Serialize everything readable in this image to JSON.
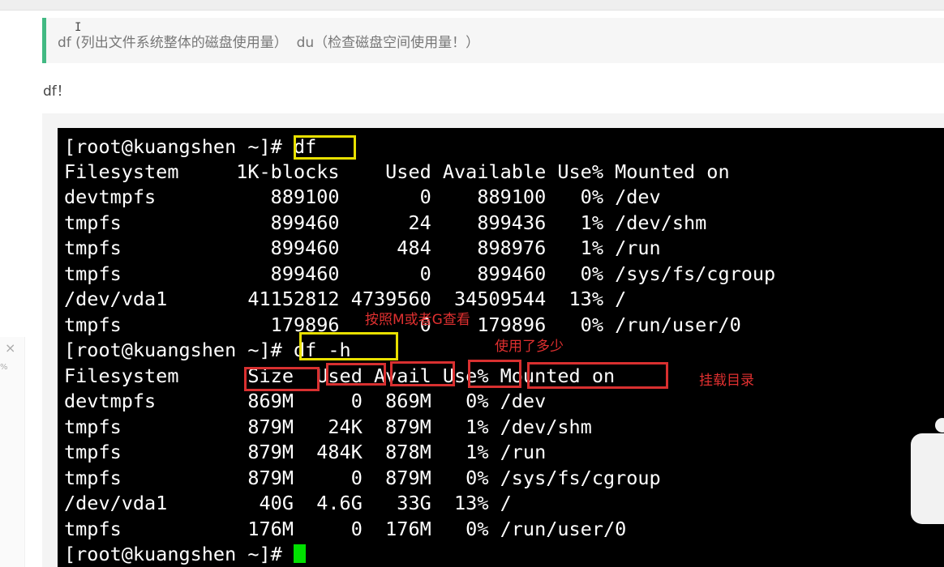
{
  "quote": {
    "text": "df (列出文件系统整体的磁盘使用量）  du（检查磁盘空间使用量！）"
  },
  "para": {
    "text": "df！"
  },
  "side": {
    "close": "×",
    "pct": "%"
  },
  "colors": {
    "accent": "#42b983",
    "highlight_yellow": "#e8e000",
    "highlight_red": "#d83030",
    "terminal_cursor": "#00e000"
  },
  "terminal": {
    "lines": [
      "[root@kuangshen ~]# df",
      "Filesystem     1K-blocks    Used Available Use% Mounted on",
      "devtmpfs          889100       0    889100   0% /dev",
      "tmpfs             899460      24    899436   1% /dev/shm",
      "tmpfs             899460     484    898976   1% /run",
      "tmpfs             899460       0    899460   0% /sys/fs/cgroup",
      "/dev/vda1       41152812 4739560  34509544  13% /",
      "tmpfs             179896       0    179896   0% /run/user/0",
      "[root@kuangshen ~]# df -h",
      "Filesystem      Size  Used Avail Use% Mounted on",
      "devtmpfs        869M     0  869M   0% /dev",
      "tmpfs           879M   24K  879M   1% /dev/shm",
      "tmpfs           879M  484K  878M   1% /run",
      "tmpfs           879M     0  879M   0% /sys/fs/cgroup",
      "/dev/vda1        40G  4.6G   33G  13% /",
      "tmpfs           176M     0  176M   0% /run/user/0",
      "[root@kuangshen ~]# "
    ]
  },
  "annotations": {
    "view_by_mg": "按照M或者G查看",
    "how_much_used": "使用了多少",
    "mount_dir": "挂载目录"
  }
}
